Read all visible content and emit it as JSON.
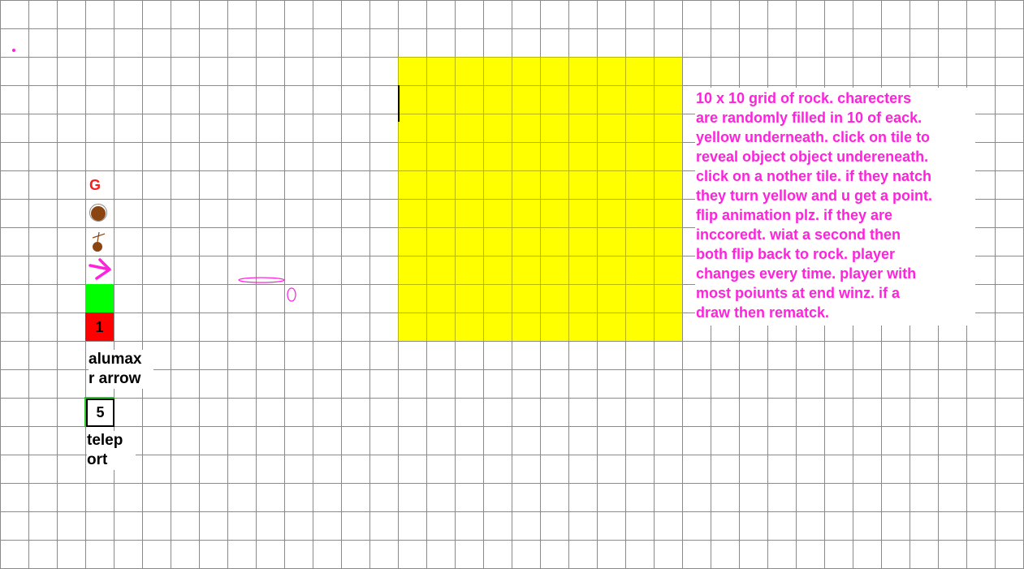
{
  "board": {
    "rows": 10,
    "cols": 10,
    "tile_color": "#ffff00"
  },
  "instructions": {
    "text": "10 x 10 grid of rock. charecters\nare randomly filled in 10 of eack.\nyellow underneath. click on tile to\nreveal object object undereneath.\nclick on a nother tile. if they natch\nthey turn yellow and u get a point.\nflip animation plz. if they are\ninccoredt. wiat a second then\nboth flip back to rock. player\nchanges every time. player with\nmost poiunts at end winz. if a\ndraw then rematck.",
    "color": "#ff22dd"
  },
  "legend": {
    "g_label": "G",
    "g_color": "#ff1a1a",
    "ball_icon": "brown-ball-icon",
    "ball_color": "#8b4513",
    "bomb_icon": "brown-bomb-icon",
    "arrow_icon": "magenta-arrow-icon",
    "arrow_color": "#ff22dd",
    "green_color": "#00ff00",
    "red_color": "#ff0000",
    "red_number": "1",
    "red_caption": "alumax\nr arrow",
    "teleport_number": "5",
    "teleport_caption": "telep\nort"
  }
}
